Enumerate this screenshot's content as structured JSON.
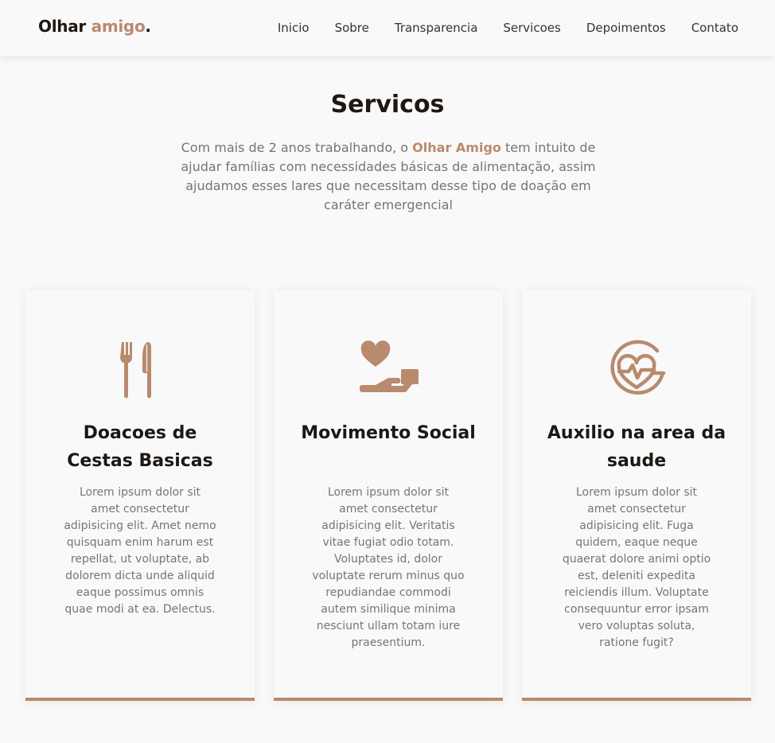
{
  "header": {
    "logo_main": "Olhar",
    "logo_accent": "amigo",
    "logo_dot": ".",
    "nav": [
      "Inicio",
      "Sobre",
      "Transparencia",
      "Servicoes",
      "Depoimentos",
      "Contato"
    ]
  },
  "services": {
    "title": "Servicos",
    "intro_before": "Com mais de 2 anos trabalhando, o ",
    "intro_brand": "Olhar Amigo",
    "intro_after": " tem intuito de ajudar famílias com necessidades básicas de alimentação, assim ajudamos esses lares que necessitam desse tipo de doação em caráter emergencial",
    "cards": [
      {
        "icon": "fork-knife-icon",
        "title": "Doacoes de Cestas Basicas",
        "text": "Lorem ipsum dolor sit amet consectetur adipisicing elit. Amet nemo quisquam enim harum est repellat, ut voluptate, ab dolorem dicta unde aliquid eaque possimus omnis quae modi at ea. Delectus."
      },
      {
        "icon": "heart-hand-icon",
        "title": "Movimento Social",
        "text": "Lorem ipsum dolor sit amet consectetur adipisicing elit. Veritatis vitae fugiat odio totam. Voluptates id, dolor voluptate rerum minus quo repudiandae commodi autem similique minima nesciunt ullam totam iure praesentium."
      },
      {
        "icon": "heart-pulse-icon",
        "title": "Auxilio na area da saude",
        "text": "Lorem ipsum dolor sit amet consectetur adipisicing elit. Fuga quidem, eaque neque quaerat dolore animi optio est, deleniti expedita reiciendis illum. Voluptate consequuntur error ipsam vero voluptas soluta, ratione fugit?"
      }
    ]
  },
  "colors": {
    "accent": "#b98a6e",
    "heading": "#1e1712",
    "body_text": "#7a7470",
    "background": "#f9f9f9"
  }
}
